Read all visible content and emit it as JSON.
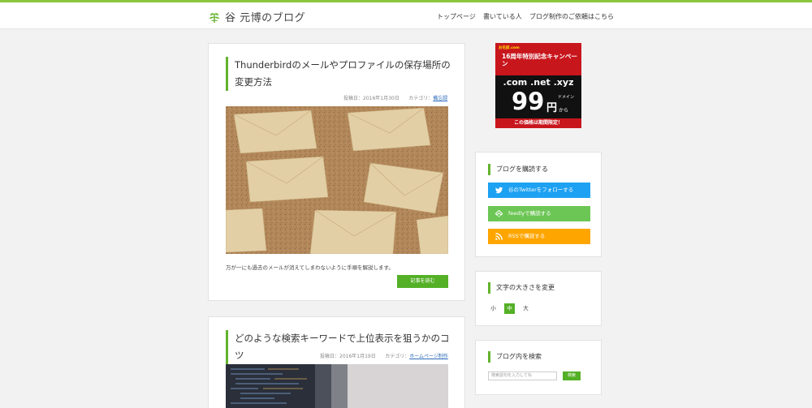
{
  "site": {
    "title": "谷 元博のブログ"
  },
  "nav": [
    {
      "label": "トップページ"
    },
    {
      "label": "書いている人"
    },
    {
      "label": "ブログ制作のご依頼はこちら"
    }
  ],
  "posts": [
    {
      "title": "Thunderbirdのメールやプロファイルの保存場所の変更方法",
      "date": "投稿日：2016年1月30日",
      "category_label": "カテゴリ：",
      "category": "備忘録",
      "excerpt": "万が一にも過去のメールが消えてしまわないように手順を解説します。",
      "readmore": "記事を読む"
    },
    {
      "title": "どのような検索キーワードで上位表示を狙うかのコツ",
      "date": "投稿日：2016年1月19日",
      "category_label": "カテゴリ：",
      "category": "ホームページ制作"
    }
  ],
  "ad": {
    "brand": "お名前.com",
    "headline": "16周年特別記念キャンペーン",
    "tlds": ".com .net .xyz",
    "price": "99",
    "currency": "円",
    "domain_label": "ドメイン",
    "from": "から",
    "footer": "この価格は期間限定！"
  },
  "widgets": {
    "subscribe": {
      "title": "ブログを購読する",
      "twitter": "谷のTwitterをフォローする",
      "feedly": "feedlyで購読する",
      "rss": "RSSで購読する"
    },
    "fontsize": {
      "title": "文字の大きさを変更",
      "small": "小",
      "medium": "中",
      "large": "大"
    },
    "search": {
      "title": "ブログ内を検索",
      "placeholder": "検索語句を入力してね",
      "button": "検索"
    }
  },
  "colors": {
    "accent": "#63b32e",
    "twitter": "#1da1f2",
    "feedly": "#6cc655",
    "rss": "#ffa500"
  }
}
